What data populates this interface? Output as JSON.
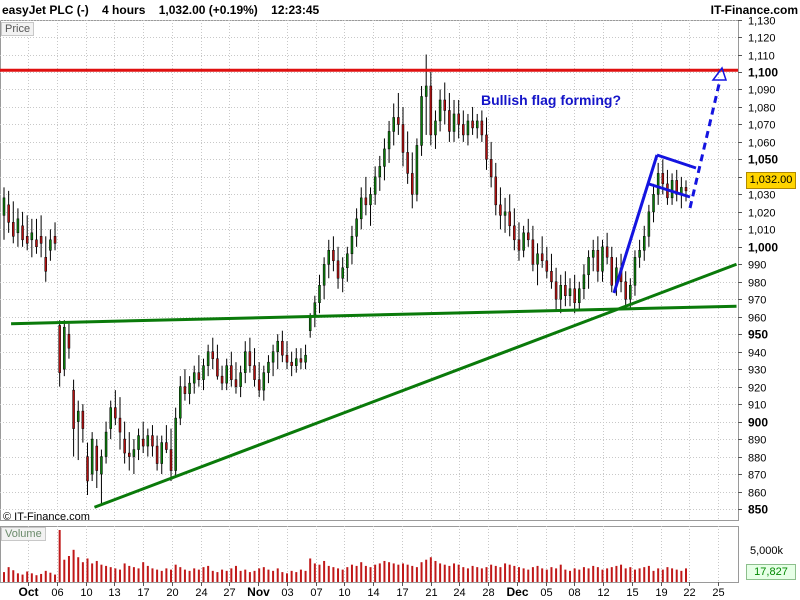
{
  "header": {
    "instrument": "easyJet PLC (-)",
    "timeframe": "4 hours",
    "price_change": "1,032.00 (+0.19%)",
    "time": "12:23:45",
    "brand": "IT-Finance.com"
  },
  "panel_labels": {
    "price": "Price",
    "volume": "Volume",
    "copyright": "© IT-Finance.com"
  },
  "annotation": {
    "text": "Bullish flag forming?"
  },
  "current_price_label": "1,032.00",
  "volume_current_label": "17,827",
  "volume_axis_label": "5,000k",
  "colors": {
    "resistance": "#e01010",
    "support": "#0a7a0a",
    "flag": "#1414e0",
    "annotation": "#1414c8",
    "up_candle": "#0a7a0a",
    "down_candle": "#b01010",
    "volume_bar": "#c01818",
    "grid": "#c8c8c8"
  },
  "chart_data": {
    "type": "candlestick",
    "title": "easyJet PLC (-)",
    "timeframe": "4 hours",
    "x_tick_labels": [
      {
        "label": "Oct",
        "bold": true
      },
      {
        "label": "06"
      },
      {
        "label": "10"
      },
      {
        "label": "13"
      },
      {
        "label": "17"
      },
      {
        "label": "20"
      },
      {
        "label": "24"
      },
      {
        "label": "27"
      },
      {
        "label": "Nov",
        "bold": true
      },
      {
        "label": "03"
      },
      {
        "label": "07"
      },
      {
        "label": "10"
      },
      {
        "label": "14"
      },
      {
        "label": "17"
      },
      {
        "label": "21"
      },
      {
        "label": "24"
      },
      {
        "label": "28"
      },
      {
        "label": "Dec",
        "bold": true
      },
      {
        "label": "05"
      },
      {
        "label": "08"
      },
      {
        "label": "12"
      },
      {
        "label": "15"
      },
      {
        "label": "19"
      },
      {
        "label": "22"
      },
      {
        "label": "25"
      }
    ],
    "y_ticks": [
      {
        "v": 850,
        "bold": true
      },
      {
        "v": 860
      },
      {
        "v": 870
      },
      {
        "v": 880
      },
      {
        "v": 890
      },
      {
        "v": 900,
        "bold": true
      },
      {
        "v": 910
      },
      {
        "v": 920
      },
      {
        "v": 930
      },
      {
        "v": 940
      },
      {
        "v": 950,
        "bold": true
      },
      {
        "v": 960
      },
      {
        "v": 970
      },
      {
        "v": 980
      },
      {
        "v": 990
      },
      {
        "v": 1000,
        "bold": true
      },
      {
        "v": 1010
      },
      {
        "v": 1020
      },
      {
        "v": 1030
      },
      {
        "v": 1040
      },
      {
        "v": 1050,
        "bold": true
      },
      {
        "v": 1060
      },
      {
        "v": 1070
      },
      {
        "v": 1080
      },
      {
        "v": 1090
      },
      {
        "v": 1100,
        "bold": true
      },
      {
        "v": 1110
      },
      {
        "v": 1120
      },
      {
        "v": 1130
      }
    ],
    "ylim": [
      845,
      1133
    ],
    "grid": true,
    "current_price": 1032,
    "candles": [
      {
        "o": 1018,
        "h": 1034,
        "l": 1004,
        "c": 1028
      },
      {
        "o": 1024,
        "h": 1032,
        "l": 1008,
        "c": 1014
      },
      {
        "o": 1014,
        "h": 1026,
        "l": 1002,
        "c": 1006
      },
      {
        "o": 1008,
        "h": 1022,
        "l": 1000,
        "c": 1016
      },
      {
        "o": 1012,
        "h": 1020,
        "l": 1000,
        "c": 1004
      },
      {
        "o": 1006,
        "h": 1018,
        "l": 998,
        "c": 1002
      },
      {
        "o": 1004,
        "h": 1016,
        "l": 994,
        "c": 1008
      },
      {
        "o": 1004,
        "h": 1016,
        "l": 996,
        "c": 1000
      },
      {
        "o": 1006,
        "h": 1018,
        "l": 994,
        "c": 1002
      },
      {
        "o": 994,
        "h": 1006,
        "l": 980,
        "c": 986
      },
      {
        "o": 998,
        "h": 1010,
        "l": 992,
        "c": 1004
      },
      {
        "o": 1006,
        "h": 1014,
        "l": 998,
        "c": 1002
      },
      {
        "o": 955,
        "h": 958,
        "l": 920,
        "c": 928
      },
      {
        "o": 930,
        "h": 958,
        "l": 926,
        "c": 954
      },
      {
        "o": 950,
        "h": 956,
        "l": 936,
        "c": 942
      },
      {
        "o": 918,
        "h": 924,
        "l": 880,
        "c": 896
      },
      {
        "o": 900,
        "h": 912,
        "l": 878,
        "c": 906
      },
      {
        "o": 906,
        "h": 910,
        "l": 888,
        "c": 896
      },
      {
        "o": 880,
        "h": 888,
        "l": 858,
        "c": 866
      },
      {
        "o": 870,
        "h": 894,
        "l": 866,
        "c": 890
      },
      {
        "o": 886,
        "h": 890,
        "l": 862,
        "c": 872
      },
      {
        "o": 870,
        "h": 884,
        "l": 852,
        "c": 880
      },
      {
        "o": 880,
        "h": 900,
        "l": 876,
        "c": 894
      },
      {
        "o": 896,
        "h": 912,
        "l": 890,
        "c": 908
      },
      {
        "o": 908,
        "h": 918,
        "l": 898,
        "c": 902
      },
      {
        "o": 902,
        "h": 914,
        "l": 884,
        "c": 894
      },
      {
        "o": 890,
        "h": 900,
        "l": 876,
        "c": 882
      },
      {
        "o": 882,
        "h": 894,
        "l": 872,
        "c": 880
      },
      {
        "o": 880,
        "h": 890,
        "l": 870,
        "c": 884
      },
      {
        "o": 884,
        "h": 896,
        "l": 878,
        "c": 892
      },
      {
        "o": 890,
        "h": 900,
        "l": 882,
        "c": 886
      },
      {
        "o": 886,
        "h": 896,
        "l": 880,
        "c": 892
      },
      {
        "o": 892,
        "h": 898,
        "l": 880,
        "c": 886
      },
      {
        "o": 886,
        "h": 892,
        "l": 872,
        "c": 876
      },
      {
        "o": 876,
        "h": 892,
        "l": 870,
        "c": 888
      },
      {
        "o": 888,
        "h": 898,
        "l": 882,
        "c": 884
      },
      {
        "o": 884,
        "h": 896,
        "l": 866,
        "c": 872
      },
      {
        "o": 872,
        "h": 908,
        "l": 868,
        "c": 902
      },
      {
        "o": 902,
        "h": 926,
        "l": 898,
        "c": 920
      },
      {
        "o": 920,
        "h": 930,
        "l": 912,
        "c": 916
      },
      {
        "o": 916,
        "h": 926,
        "l": 910,
        "c": 922
      },
      {
        "o": 922,
        "h": 932,
        "l": 916,
        "c": 928
      },
      {
        "o": 928,
        "h": 938,
        "l": 920,
        "c": 924
      },
      {
        "o": 924,
        "h": 936,
        "l": 918,
        "c": 932
      },
      {
        "o": 932,
        "h": 944,
        "l": 926,
        "c": 940
      },
      {
        "o": 940,
        "h": 948,
        "l": 930,
        "c": 936
      },
      {
        "o": 936,
        "h": 944,
        "l": 924,
        "c": 926
      },
      {
        "o": 926,
        "h": 932,
        "l": 918,
        "c": 922
      },
      {
        "o": 922,
        "h": 936,
        "l": 918,
        "c": 932
      },
      {
        "o": 932,
        "h": 940,
        "l": 920,
        "c": 924
      },
      {
        "o": 924,
        "h": 934,
        "l": 916,
        "c": 920
      },
      {
        "o": 920,
        "h": 932,
        "l": 914,
        "c": 928
      },
      {
        "o": 928,
        "h": 946,
        "l": 922,
        "c": 940
      },
      {
        "o": 940,
        "h": 948,
        "l": 928,
        "c": 932
      },
      {
        "o": 932,
        "h": 942,
        "l": 920,
        "c": 924
      },
      {
        "o": 924,
        "h": 934,
        "l": 914,
        "c": 918
      },
      {
        "o": 918,
        "h": 932,
        "l": 912,
        "c": 928
      },
      {
        "o": 928,
        "h": 938,
        "l": 922,
        "c": 934
      },
      {
        "o": 934,
        "h": 944,
        "l": 926,
        "c": 940
      },
      {
        "o": 940,
        "h": 950,
        "l": 930,
        "c": 946
      },
      {
        "o": 946,
        "h": 952,
        "l": 934,
        "c": 938
      },
      {
        "o": 938,
        "h": 946,
        "l": 930,
        "c": 934
      },
      {
        "o": 934,
        "h": 940,
        "l": 926,
        "c": 932
      },
      {
        "o": 932,
        "h": 942,
        "l": 928,
        "c": 936
      },
      {
        "o": 936,
        "h": 942,
        "l": 930,
        "c": 934
      },
      {
        "o": 934,
        "h": 944,
        "l": 930,
        "c": 938
      },
      {
        "o": 952,
        "h": 962,
        "l": 948,
        "c": 960
      },
      {
        "o": 960,
        "h": 972,
        "l": 954,
        "c": 968
      },
      {
        "o": 968,
        "h": 984,
        "l": 962,
        "c": 978
      },
      {
        "o": 978,
        "h": 994,
        "l": 970,
        "c": 990
      },
      {
        "o": 990,
        "h": 1004,
        "l": 982,
        "c": 998
      },
      {
        "o": 998,
        "h": 1006,
        "l": 986,
        "c": 992
      },
      {
        "o": 992,
        "h": 1000,
        "l": 976,
        "c": 982
      },
      {
        "o": 982,
        "h": 994,
        "l": 974,
        "c": 988
      },
      {
        "o": 988,
        "h": 1000,
        "l": 980,
        "c": 996
      },
      {
        "o": 996,
        "h": 1012,
        "l": 990,
        "c": 1006
      },
      {
        "o": 1006,
        "h": 1022,
        "l": 1000,
        "c": 1016
      },
      {
        "o": 1016,
        "h": 1034,
        "l": 1010,
        "c": 1028
      },
      {
        "o": 1028,
        "h": 1040,
        "l": 1018,
        "c": 1024
      },
      {
        "o": 1024,
        "h": 1034,
        "l": 1012,
        "c": 1030
      },
      {
        "o": 1030,
        "h": 1046,
        "l": 1024,
        "c": 1040
      },
      {
        "o": 1040,
        "h": 1052,
        "l": 1032,
        "c": 1046
      },
      {
        "o": 1046,
        "h": 1062,
        "l": 1038,
        "c": 1056
      },
      {
        "o": 1056,
        "h": 1072,
        "l": 1048,
        "c": 1066
      },
      {
        "o": 1066,
        "h": 1082,
        "l": 1058,
        "c": 1074
      },
      {
        "o": 1074,
        "h": 1088,
        "l": 1064,
        "c": 1070
      },
      {
        "o": 1070,
        "h": 1080,
        "l": 1046,
        "c": 1054
      },
      {
        "o": 1054,
        "h": 1066,
        "l": 1036,
        "c": 1042
      },
      {
        "o": 1042,
        "h": 1054,
        "l": 1022,
        "c": 1030
      },
      {
        "o": 1030,
        "h": 1062,
        "l": 1026,
        "c": 1058
      },
      {
        "o": 1058,
        "h": 1092,
        "l": 1052,
        "c": 1086
      },
      {
        "o": 1086,
        "h": 1110,
        "l": 1064,
        "c": 1092
      },
      {
        "o": 1092,
        "h": 1100,
        "l": 1058,
        "c": 1064
      },
      {
        "o": 1064,
        "h": 1078,
        "l": 1056,
        "c": 1072
      },
      {
        "o": 1072,
        "h": 1090,
        "l": 1066,
        "c": 1084
      },
      {
        "o": 1084,
        "h": 1094,
        "l": 1070,
        "c": 1078
      },
      {
        "o": 1078,
        "h": 1088,
        "l": 1060,
        "c": 1066
      },
      {
        "o": 1066,
        "h": 1084,
        "l": 1060,
        "c": 1076
      },
      {
        "o": 1076,
        "h": 1084,
        "l": 1062,
        "c": 1070
      },
      {
        "o": 1070,
        "h": 1078,
        "l": 1060,
        "c": 1064
      },
      {
        "o": 1064,
        "h": 1076,
        "l": 1058,
        "c": 1072
      },
      {
        "o": 1072,
        "h": 1080,
        "l": 1064,
        "c": 1068
      },
      {
        "o": 1068,
        "h": 1076,
        "l": 1062,
        "c": 1072
      },
      {
        "o": 1072,
        "h": 1078,
        "l": 1060,
        "c": 1064
      },
      {
        "o": 1064,
        "h": 1074,
        "l": 1044,
        "c": 1050
      },
      {
        "o": 1050,
        "h": 1060,
        "l": 1034,
        "c": 1040
      },
      {
        "o": 1040,
        "h": 1048,
        "l": 1018,
        "c": 1024
      },
      {
        "o": 1024,
        "h": 1034,
        "l": 1010,
        "c": 1018
      },
      {
        "o": 1018,
        "h": 1028,
        "l": 1008,
        "c": 1020
      },
      {
        "o": 1020,
        "h": 1030,
        "l": 1006,
        "c": 1012
      },
      {
        "o": 1012,
        "h": 1022,
        "l": 998,
        "c": 1004
      },
      {
        "o": 1004,
        "h": 1014,
        "l": 992,
        "c": 998
      },
      {
        "o": 998,
        "h": 1012,
        "l": 994,
        "c": 1008
      },
      {
        "o": 1008,
        "h": 1016,
        "l": 1000,
        "c": 1004
      },
      {
        "o": 1004,
        "h": 1012,
        "l": 986,
        "c": 990
      },
      {
        "o": 990,
        "h": 1002,
        "l": 978,
        "c": 996
      },
      {
        "o": 996,
        "h": 1006,
        "l": 988,
        "c": 992
      },
      {
        "o": 992,
        "h": 1000,
        "l": 982,
        "c": 986
      },
      {
        "o": 986,
        "h": 996,
        "l": 976,
        "c": 980
      },
      {
        "o": 980,
        "h": 988,
        "l": 964,
        "c": 970
      },
      {
        "o": 970,
        "h": 984,
        "l": 962,
        "c": 978
      },
      {
        "o": 978,
        "h": 986,
        "l": 966,
        "c": 972
      },
      {
        "o": 972,
        "h": 982,
        "l": 966,
        "c": 976
      },
      {
        "o": 976,
        "h": 984,
        "l": 962,
        "c": 968
      },
      {
        "o": 968,
        "h": 980,
        "l": 964,
        "c": 976
      },
      {
        "o": 976,
        "h": 990,
        "l": 970,
        "c": 984
      },
      {
        "o": 984,
        "h": 998,
        "l": 976,
        "c": 994
      },
      {
        "o": 994,
        "h": 1004,
        "l": 986,
        "c": 998
      },
      {
        "o": 998,
        "h": 1006,
        "l": 980,
        "c": 986
      },
      {
        "o": 986,
        "h": 1004,
        "l": 980,
        "c": 1000
      },
      {
        "o": 1000,
        "h": 1008,
        "l": 990,
        "c": 994
      },
      {
        "o": 994,
        "h": 1000,
        "l": 974,
        "c": 978
      },
      {
        "o": 978,
        "h": 994,
        "l": 972,
        "c": 988
      },
      {
        "o": 988,
        "h": 996,
        "l": 974,
        "c": 980
      },
      {
        "o": 980,
        "h": 986,
        "l": 966,
        "c": 970
      },
      {
        "o": 970,
        "h": 982,
        "l": 964,
        "c": 978
      },
      {
        "o": 978,
        "h": 998,
        "l": 972,
        "c": 994
      },
      {
        "o": 994,
        "h": 1004,
        "l": 988,
        "c": 998
      },
      {
        "o": 998,
        "h": 1012,
        "l": 992,
        "c": 1006
      },
      {
        "o": 1006,
        "h": 1024,
        "l": 1000,
        "c": 1020
      },
      {
        "o": 1020,
        "h": 1036,
        "l": 1014,
        "c": 1030
      },
      {
        "o": 1030,
        "h": 1048,
        "l": 1024,
        "c": 1042
      },
      {
        "o": 1042,
        "h": 1050,
        "l": 1030,
        "c": 1036
      },
      {
        "o": 1036,
        "h": 1044,
        "l": 1024,
        "c": 1028
      },
      {
        "o": 1028,
        "h": 1042,
        "l": 1024,
        "c": 1038
      },
      {
        "o": 1038,
        "h": 1044,
        "l": 1026,
        "c": 1030
      },
      {
        "o": 1030,
        "h": 1040,
        "l": 1022,
        "c": 1034
      },
      {
        "o": 1034,
        "h": 1038,
        "l": 1026,
        "c": 1032
      }
    ],
    "volume": [
      80,
      120,
      95,
      70,
      60,
      85,
      70,
      55,
      65,
      90,
      75,
      60,
      420,
      180,
      210,
      260,
      200,
      160,
      190,
      150,
      170,
      140,
      130,
      120,
      110,
      100,
      150,
      130,
      120,
      110,
      160,
      130,
      110,
      100,
      90,
      110,
      100,
      140,
      120,
      100,
      90,
      110,
      100,
      120,
      130,
      90,
      80,
      100,
      90,
      110,
      130,
      90,
      100,
      80,
      90,
      110,
      120,
      100,
      90,
      110,
      80,
      70,
      90,
      80,
      100,
      90,
      190,
      150,
      140,
      170,
      130,
      120,
      110,
      100,
      120,
      140,
      130,
      160,
      130,
      120,
      140,
      150,
      170,
      160,
      150,
      140,
      150,
      140,
      130,
      120,
      160,
      180,
      200,
      170,
      150,
      140,
      130,
      150,
      140,
      120,
      110,
      130,
      120,
      110,
      120,
      140,
      130,
      120,
      150,
      140,
      130,
      120,
      110,
      100,
      120,
      130,
      110,
      100,
      120,
      110,
      140,
      100,
      90,
      110,
      100,
      120,
      110,
      130,
      120,
      100,
      110,
      120,
      130,
      140,
      110,
      120,
      100,
      110,
      120,
      130,
      90,
      110,
      100,
      120,
      110,
      100,
      90,
      110,
      120,
      100,
      90
    ],
    "lines": [
      {
        "name": "resistance",
        "x0": 0,
        "y0": 1101,
        "x1": 1,
        "y1": 1101,
        "style": "solid"
      },
      {
        "name": "horizontal-support",
        "x0": 0.015,
        "y0": 956,
        "x1": 0.998,
        "y1": 966,
        "style": "solid"
      },
      {
        "name": "rising-trendline",
        "x0": 0.128,
        "y0": 851,
        "x1": 0.998,
        "y1": 990,
        "style": "solid"
      }
    ]
  }
}
